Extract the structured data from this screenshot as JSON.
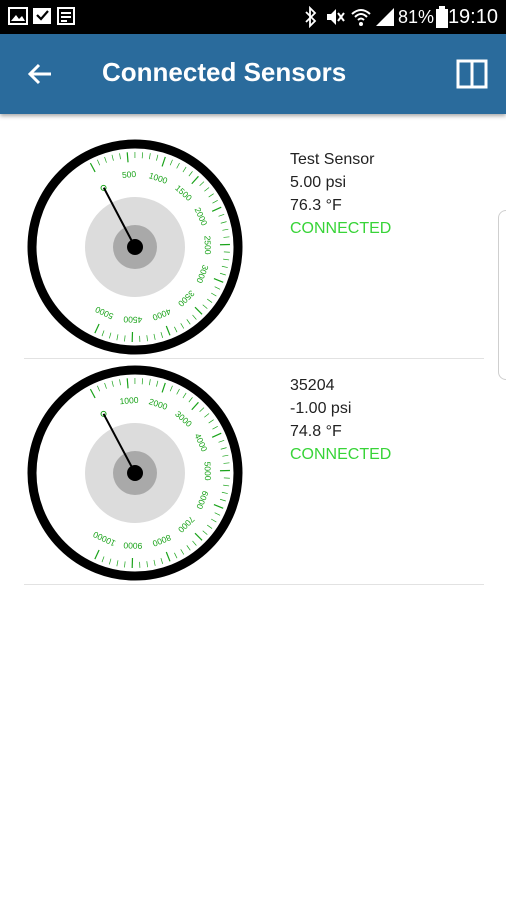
{
  "status_bar": {
    "left_icons": [
      "image-icon",
      "download-icon",
      "calendar-icon"
    ],
    "right_icons": [
      "bluetooth-icon",
      "mute-icon",
      "wifi-icon",
      "signal-icon",
      "battery-icon"
    ],
    "battery": "81%",
    "time": "19:10"
  },
  "app_bar": {
    "title": "Connected Sensors",
    "back_icon": "arrow-left-icon",
    "split_icon": "split-view-icon"
  },
  "colors": {
    "app_bar": "#2a6b9c",
    "gauge_scale": "#1aa31a",
    "connected": "#38d438"
  },
  "sensors": [
    {
      "name": "Test Sensor",
      "pressure": "5.00 psi",
      "temperature": "76.3 °F",
      "status": "CONNECTED",
      "gauge": {
        "min": 0,
        "max": 5000,
        "step": 500,
        "reading": 5.0,
        "labels": [
          "500",
          "1000",
          "1500",
          "2000",
          "2500",
          "3000",
          "3500",
          "4000",
          "4500",
          "5000"
        ]
      }
    },
    {
      "name": "35204",
      "pressure": "-1.00 psi",
      "temperature": "74.8 °F",
      "status": "CONNECTED",
      "gauge": {
        "min": 0,
        "max": 10000,
        "step": 1000,
        "reading": -1.0,
        "labels": [
          "1000",
          "2000",
          "3000",
          "4000",
          "5000",
          "6000",
          "7000",
          "8000",
          "9000",
          "10000"
        ]
      }
    }
  ]
}
